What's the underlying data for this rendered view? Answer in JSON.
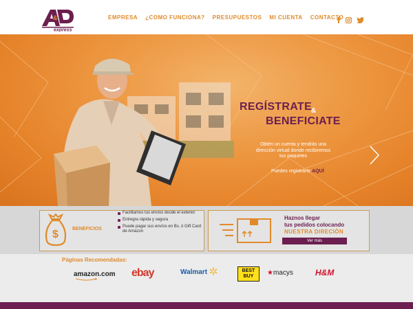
{
  "header": {
    "logo_text_top": "A&D",
    "logo_text_bottom": "express",
    "nav": [
      {
        "label": "EMPRESA"
      },
      {
        "label": "¿COMO FUNCIONA?"
      },
      {
        "label": "PRESUPUESTOS"
      },
      {
        "label": "MI CUENTA"
      },
      {
        "label": "CONTACTO"
      }
    ],
    "social_icons": [
      "facebook-icon",
      "instagram-icon",
      "twitter-icon"
    ]
  },
  "hero": {
    "title_line1": "REGÍSTRATE",
    "amp": "&",
    "title_line2": "BENEFICIATE",
    "description": "Obtén un cuenta y tendrás una dirección virtual donde recibiremos tus paquetes",
    "register_text": "Puedes registrarte",
    "register_link": "AQUÍ"
  },
  "features": {
    "benefits_label": "BENEFICIOS",
    "benefits": [
      "Facilitamos tus envíos desde el exterior",
      "Entregra rápida y segura",
      "Puede pagar sus envíos en Bs. ó Gift Card de Amazon"
    ],
    "promo_line1": "Haznos llegar",
    "promo_line2": "tus pedidos colocando",
    "promo_line3": "NUESTRA DIRECIÓN",
    "more_button": "Ver más"
  },
  "recommended": {
    "label": "Páginas Recomendadas:",
    "brands": [
      "amazon.com",
      "ebay",
      "Walmart",
      "BEST BUY",
      "macys",
      "H&M"
    ]
  },
  "colors": {
    "brand_purple": "#6b1e4f",
    "brand_orange": "#e08a2a"
  }
}
